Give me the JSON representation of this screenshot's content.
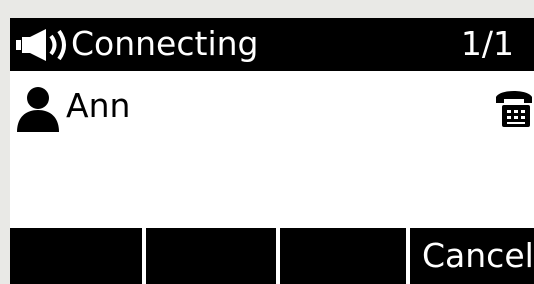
{
  "status_bar": {
    "status_text": "Connecting",
    "call_count": "1/1",
    "icon": "speaker-volume-icon"
  },
  "contact": {
    "name": "Ann",
    "avatar_icon": "person-icon",
    "line_icon": "telephone-icon"
  },
  "softkeys": [
    {
      "label": ""
    },
    {
      "label": ""
    },
    {
      "label": ""
    },
    {
      "label": "Cancel"
    }
  ],
  "colors": {
    "screen_background": "#ffffff",
    "bar_background": "#000000",
    "bar_text": "#ffffff",
    "body_text": "#000000",
    "bezel": "#e9e9e6"
  }
}
